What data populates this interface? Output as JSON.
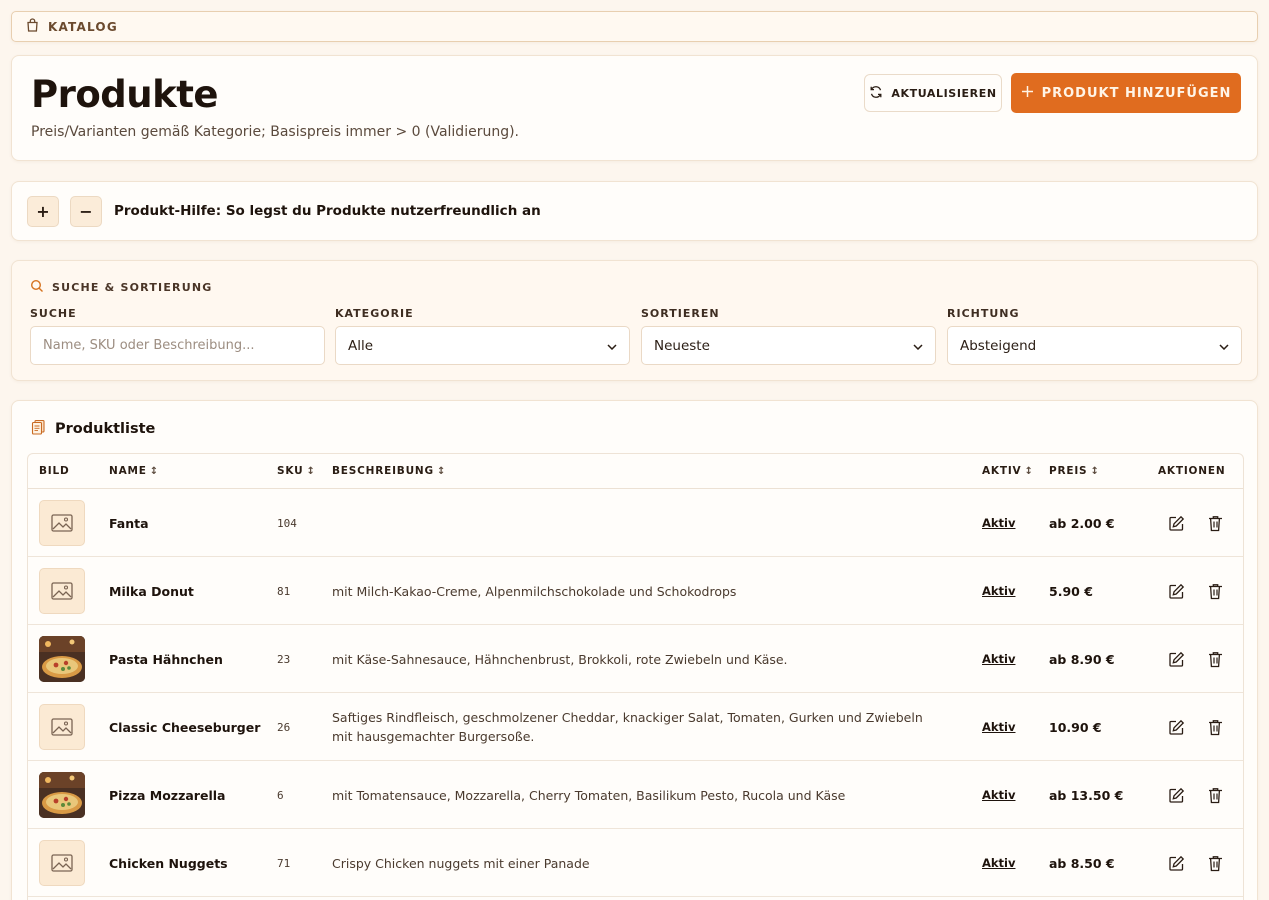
{
  "breadcrumb": {
    "label": "KATALOG",
    "icon": "shopping-bag-icon"
  },
  "header": {
    "title": "Produkte",
    "subtitle": "Preis/Varianten gemäß Kategorie; Basispreis immer > 0 (Validierung).",
    "refresh_label": "AKTUALISIEREN",
    "add_label": "PRODUKT HINZUFÜGEN",
    "accent": "#e06c1f"
  },
  "help": {
    "plus": "+",
    "minus": "−",
    "text": "Produkt-Hilfe: So legst du Produkte nutzerfreundlich an"
  },
  "filter": {
    "title": "SUCHE & SORTIERUNG",
    "search_label": "SUCHE",
    "search_placeholder": "Name, SKU oder Beschreibung...",
    "category_label": "KATEGORIE",
    "category_value": "Alle",
    "sort_label": "SORTIEREN",
    "sort_value": "Neueste",
    "direction_label": "RICHTUNG",
    "direction_value": "Absteigend"
  },
  "list": {
    "title": "Produktliste",
    "columns": {
      "image": "BILD",
      "name": "NAME",
      "sku": "SKU",
      "description": "BESCHREIBUNG",
      "active": "AKTIV",
      "price": "PREIS",
      "actions": "AKTIONEN"
    },
    "sort_glyph": "↕",
    "rows": [
      {
        "image": "placeholder",
        "name": "Fanta",
        "sku": "104",
        "description": "",
        "status": "Aktiv",
        "price": "ab 2.00 €"
      },
      {
        "image": "placeholder",
        "name": "Milka Donut",
        "sku": "81",
        "description": "mit Milch-Kakao-Creme, Alpenmilchschokolade und Schokodrops",
        "status": "Aktiv",
        "price": "5.90 €"
      },
      {
        "image": "photo",
        "name": "Pasta Hähnchen",
        "sku": "23",
        "description": "mit Käse-Sahnesauce, Hähnchenbrust, Brokkoli, rote Zwiebeln und Käse.",
        "status": "Aktiv",
        "price": "ab 8.90 €"
      },
      {
        "image": "placeholder",
        "name": "Classic Cheeseburger",
        "sku": "26",
        "description": "Saftiges Rindfleisch, geschmolzener Cheddar, knackiger Salat, Tomaten, Gurken und Zwiebeln mit hausgemachter Burgersoße.",
        "status": "Aktiv",
        "price": "10.90 €"
      },
      {
        "image": "photo",
        "name": "Pizza Mozzarella",
        "sku": "6",
        "description": "mit Tomatensauce, Mozzarella, Cherry Tomaten, Basilikum Pesto, Rucola und Käse",
        "status": "Aktiv",
        "price": "ab 13.50 €"
      },
      {
        "image": "placeholder",
        "name": "Chicken Nuggets",
        "sku": "71",
        "description": "Crispy Chicken nuggets mit einer Panade",
        "status": "Aktiv",
        "price": "ab 8.50 €"
      }
    ]
  }
}
